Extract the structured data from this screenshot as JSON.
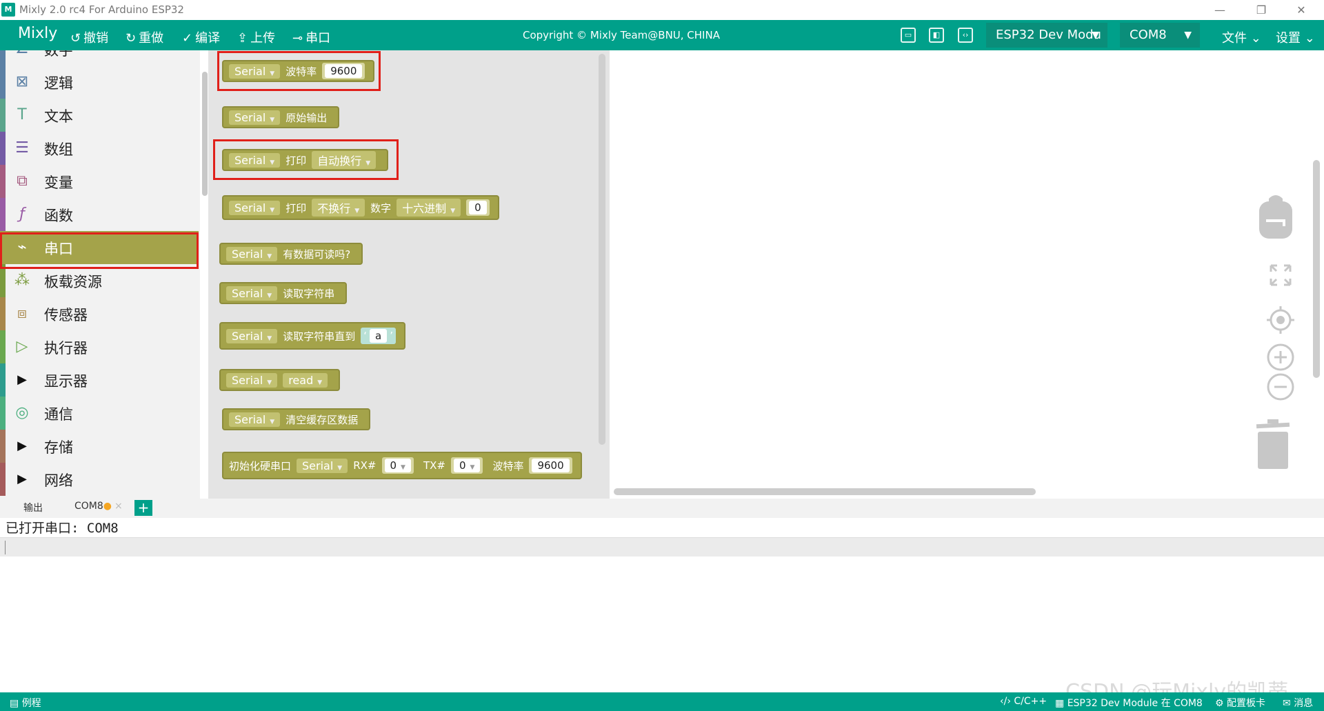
{
  "window": {
    "title": "Mixly 2.0 rc4 For Arduino ESP32",
    "logo": "M",
    "controls": [
      "—",
      "❐",
      "✕"
    ]
  },
  "toolbar": {
    "brand": "Mixly",
    "undo": "撤销",
    "redo": "重做",
    "compile": "编译",
    "upload": "上传",
    "serial": "串口",
    "copyright": "Copyright © Mixly Team@BNU, CHINA",
    "board": "ESP32 Dev Modu",
    "port": "COM8",
    "file_menu": "文件",
    "settings_menu": "设置"
  },
  "sidebar": {
    "items": [
      {
        "label": "数字",
        "color": "#5b80a5"
      },
      {
        "label": "逻辑",
        "color": "#5b80a5"
      },
      {
        "label": "文本",
        "color": "#5ba58c"
      },
      {
        "label": "数组",
        "color": "#745ba5"
      },
      {
        "label": "变量",
        "color": "#a55b80"
      },
      {
        "label": "函数",
        "color": "#995ba5"
      },
      {
        "label": "串口",
        "color": "#a4a34a"
      },
      {
        "label": "板载资源",
        "color": "#7b9b3e"
      },
      {
        "label": "传感器",
        "color": "#a8874a"
      },
      {
        "label": "执行器",
        "color": "#6aa84f"
      },
      {
        "label": "显示器",
        "color": "#2d9c8d"
      },
      {
        "label": "通信",
        "color": "#4caf7f"
      },
      {
        "label": "存储",
        "color": "#a5745b"
      },
      {
        "label": "网络",
        "color": "#a55b5b"
      }
    ],
    "active_index": 6
  },
  "blocks": {
    "serial": "Serial",
    "baud_label": "波特率",
    "baud_value": "9600",
    "raw_output": "原始输出",
    "print": "打印",
    "auto_newline": "自动换行",
    "no_newline": "不换行",
    "number": "数字",
    "hex": "十六进制",
    "zero": "0",
    "available": "有数据可读吗?",
    "read_string": "读取字符串",
    "read_until": "读取字符串直到",
    "char_a": "a",
    "read": "read",
    "flush": "清空缓存区数据",
    "init_hw": "初始化硬串口",
    "rx": "RX#",
    "tx": "TX#"
  },
  "output": {
    "tab_output": "输出",
    "tab_com": "COM8",
    "add_tab": "+",
    "console_text": "已打开串口: COM8"
  },
  "statusbar": {
    "examples": "例程",
    "language": "C/C++",
    "board_info": "ESP32 Dev Module 在 COM8",
    "board_config": "配置板卡",
    "messages": "消息"
  },
  "watermark": "CSDN @玩Mixly的凯蒂"
}
